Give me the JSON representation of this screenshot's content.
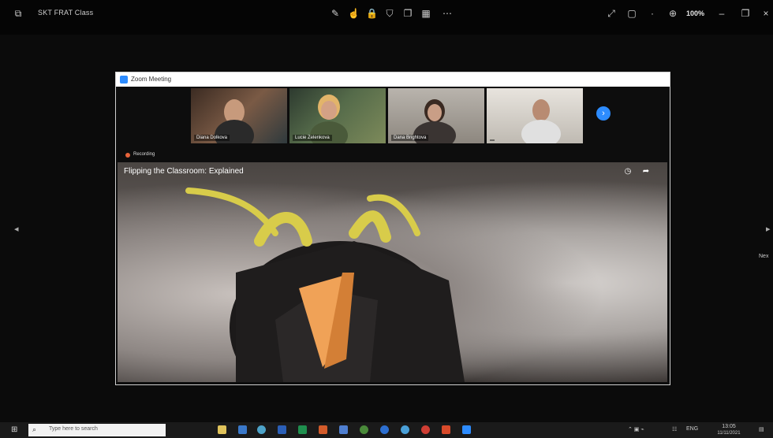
{
  "toolbar": {
    "title": "SKT FRAT Class",
    "zoom_level": "100%",
    "icons": [
      "pen-icon",
      "pointer-icon",
      "lock-icon",
      "shield-icon",
      "copy-icon",
      "grid-icon",
      "more-icon",
      "expand-icon",
      "window-icon",
      "divider-icon",
      "zoom-in-icon",
      "minimize-icon",
      "restore-icon",
      "close-icon"
    ]
  },
  "zoom_window": {
    "title": "Zoom Meeting",
    "participants": [
      {
        "name": "Diana Dolkova"
      },
      {
        "name": "Lucie Zelenkova"
      },
      {
        "name": "Dana Brightova"
      },
      {
        "name": ""
      }
    ],
    "recording_label": "Recording",
    "video_title": "Flipping the Classroom: Explained"
  },
  "side": {
    "right_label": "Nex"
  },
  "taskbar": {
    "search_placeholder": "Type here to search",
    "tray": {
      "lang": "ENG",
      "time": "13:05",
      "date": "11/11/2021"
    }
  },
  "colors": {
    "zoom_blue": "#2d8cff",
    "recording": "#e8633a"
  }
}
